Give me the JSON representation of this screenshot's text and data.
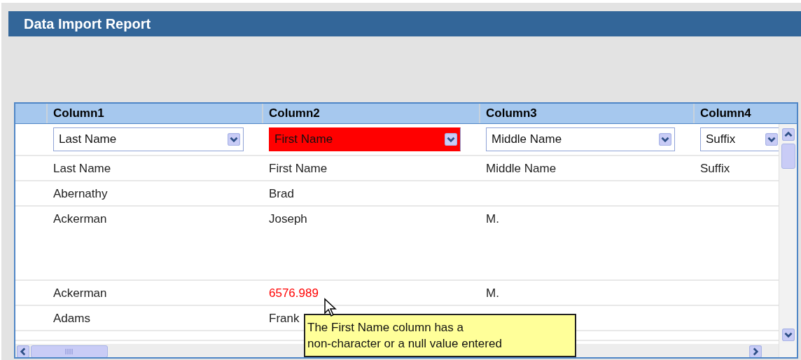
{
  "title": "Data Import Report",
  "grid": {
    "columns": [
      {
        "header": "Column1",
        "mapping": "Last Name",
        "error": false
      },
      {
        "header": "Column2",
        "mapping": "First Name",
        "error": true
      },
      {
        "header": "Column3",
        "mapping": "Middle Name",
        "error": false
      },
      {
        "header": "Column4",
        "mapping": "Suffix",
        "error": false
      }
    ],
    "rows": [
      {
        "cells": [
          {
            "text": "Last Name",
            "error": false
          },
          {
            "text": "First Name",
            "error": false
          },
          {
            "text": "Middle Name",
            "error": false
          },
          {
            "text": "Suffix",
            "error": false
          }
        ]
      },
      {
        "cells": [
          {
            "text": "Abernathy",
            "error": false
          },
          {
            "text": "Brad",
            "error": false
          }
        ]
      },
      {
        "cells": [
          {
            "text": "Ackerman",
            "error": false
          },
          {
            "text": "Joseph",
            "error": false
          },
          {
            "text": "M.",
            "error": false
          }
        ]
      },
      {
        "cells": [
          {
            "text": "Ackerman",
            "error": false
          },
          {
            "text": "6576.989",
            "error": true
          },
          {
            "text": "M.",
            "error": false
          }
        ]
      },
      {
        "cells": [
          {
            "text": "Adams",
            "error": false
          },
          {
            "text": "Frank",
            "error": false
          }
        ]
      },
      {
        "cells": []
      }
    ]
  },
  "tooltip": {
    "text": "The First Name column has a\nnon-character or a null value entered"
  }
}
